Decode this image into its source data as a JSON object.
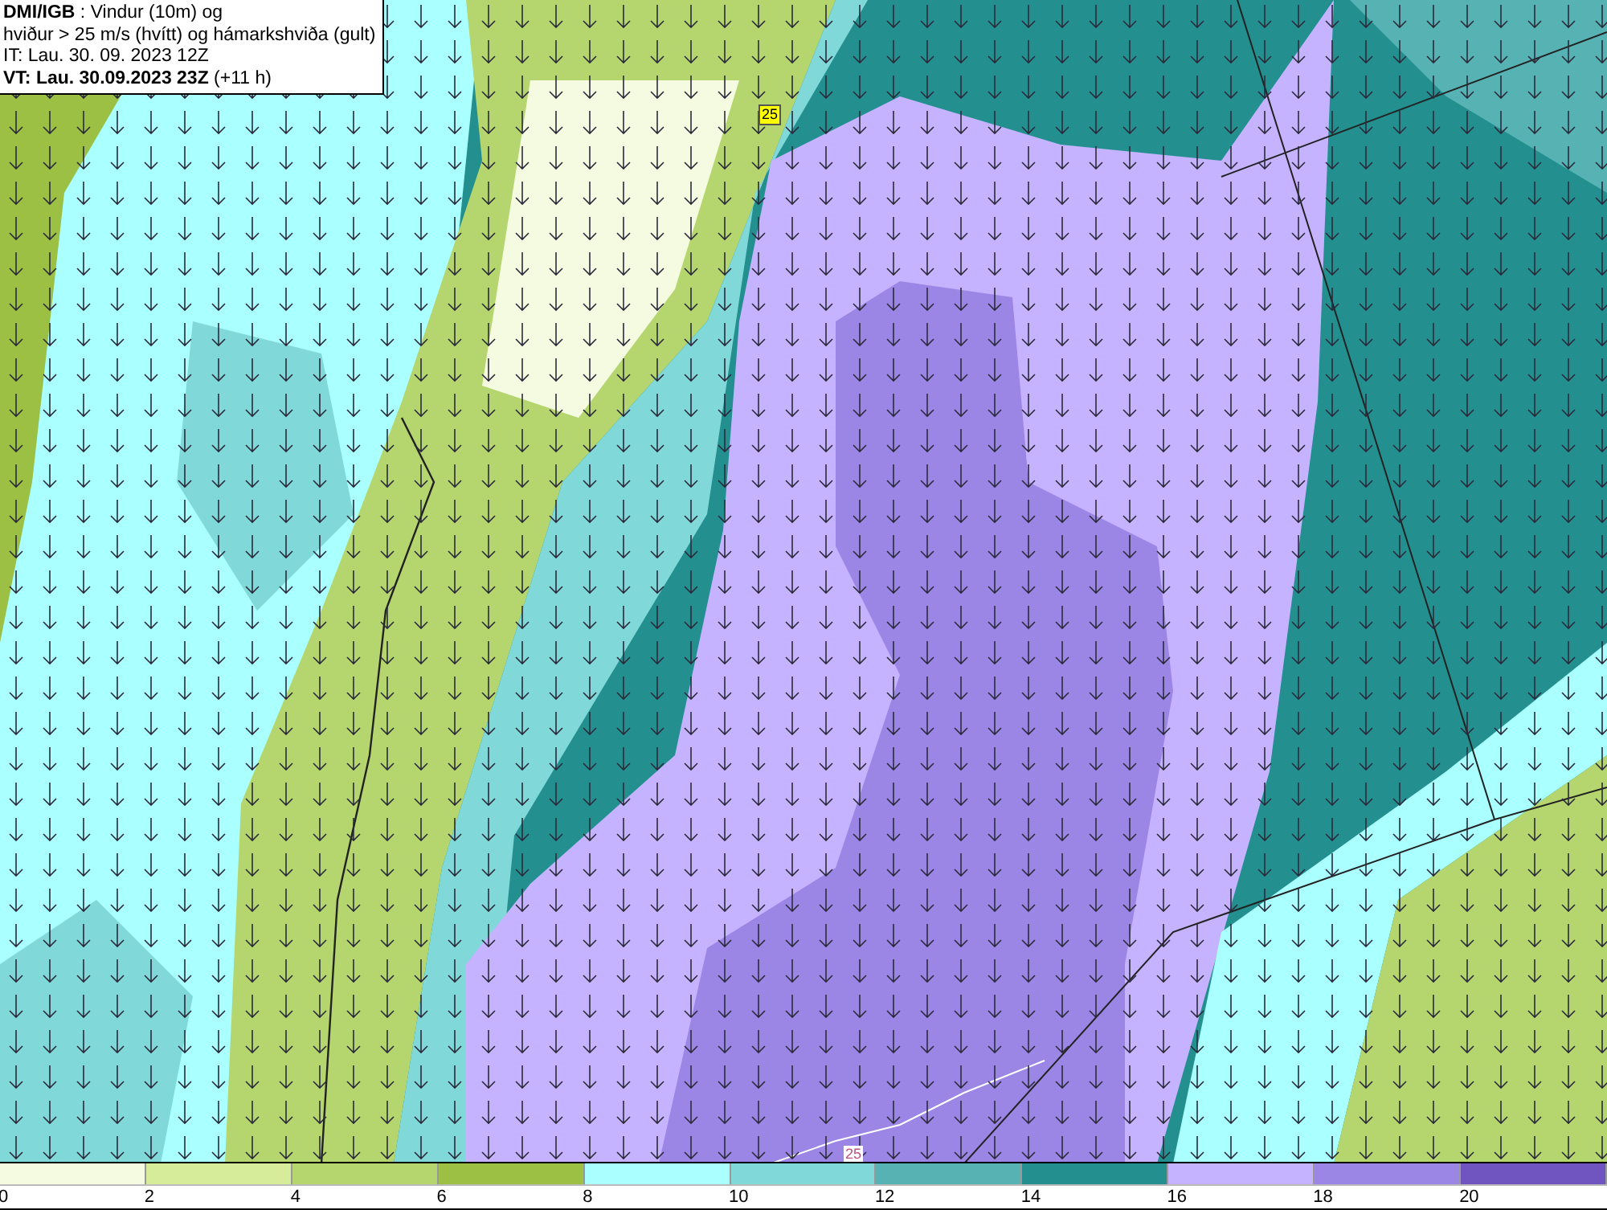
{
  "header": {
    "lines": [
      "**DMI/IGB** : Vindur (10m) og",
      "hviður > 25 m/s (hvítt) og hámarkshviða (gult)",
      "IT: Lau. 30. 09. 2023 12Z",
      "**VT: Lau. 30.09.2023 23Z** (+11 h)"
    ]
  },
  "map": {
    "max_gust_label": "25",
    "gust_contour_label": "25"
  },
  "colorbar": {
    "bins": [
      {
        "color": "#f5fbe0"
      },
      {
        "color": "#d6ec9a"
      },
      {
        "color": "#b5d66e"
      },
      {
        "color": "#9bc044"
      },
      {
        "color": "#aaffff"
      },
      {
        "color": "#80d8d8"
      },
      {
        "color": "#57b3b3"
      },
      {
        "color": "#238f8f"
      },
      {
        "color": "#c6b3ff"
      },
      {
        "color": "#9b86e6"
      },
      {
        "color": "#7055c0"
      }
    ],
    "ticks": [
      "0",
      "2",
      "4",
      "6",
      "8",
      "10",
      "12",
      "14",
      "16",
      "18",
      "20"
    ]
  }
}
